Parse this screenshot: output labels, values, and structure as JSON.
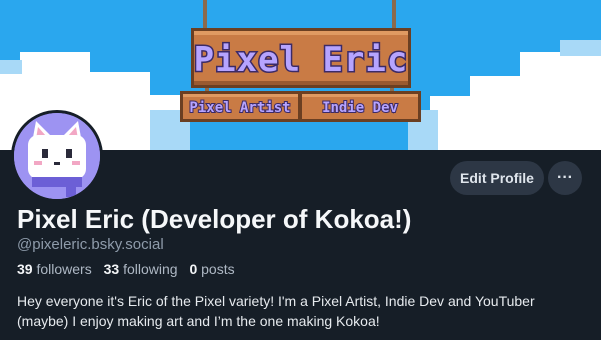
{
  "profile": {
    "banner": {
      "sign_title": "Pixel Eric",
      "sign_subtitle_left": "Pixel Artist",
      "sign_subtitle_right": "Indie Dev"
    },
    "display_name": "Pixel Eric (Developer of Kokoa!)",
    "handle": "@pixeleric.bsky.social",
    "stats": {
      "followers_count": "39",
      "followers_label": "followers",
      "following_count": "33",
      "following_label": "following",
      "posts_count": "0",
      "posts_label": "posts"
    },
    "bio": "Hey everyone it's Eric of the Pixel variety! I'm a Pixel Artist, Indie Dev and YouTuber (maybe) I enjoy making art and I’m the one making Kokoa!"
  },
  "actions": {
    "edit_profile_label": "Edit Profile",
    "more_label": "···"
  },
  "icons": {
    "avatar": "white-cat-mascot-icon",
    "more": "ellipsis-icon"
  },
  "colors": {
    "page_background": "#161e27",
    "sky": "#29a6ee",
    "sign_wood": "#c97b45",
    "sign_text": "#b6a4ff",
    "button_background": "#2d3745"
  }
}
